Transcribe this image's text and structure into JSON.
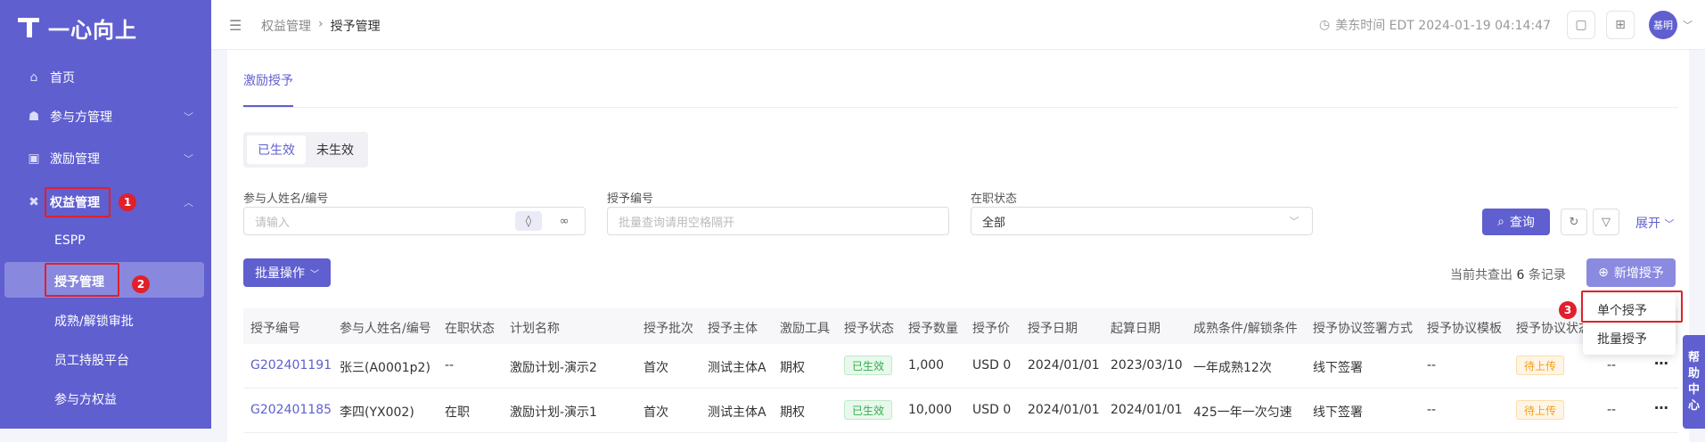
{
  "app": {
    "logo_text": "一心向上"
  },
  "sidebar": {
    "items": [
      {
        "label": "首页",
        "icon": "home-icon"
      },
      {
        "label": "参与方管理",
        "icon": "users-icon"
      },
      {
        "label": "激励管理",
        "icon": "gift-icon"
      },
      {
        "label": "权益管理",
        "icon": "equity-icon"
      }
    ],
    "sub_items": [
      "ESPP",
      "授予管理",
      "成熟/解锁审批",
      "员工持股平台",
      "参与方权益"
    ]
  },
  "annotations": {
    "b1": "1",
    "b2": "2",
    "b3": "3"
  },
  "header": {
    "breadcrumb": [
      "权益管理",
      "授予管理"
    ],
    "time": "美东时间 EDT 2024-01-19 04:14:47",
    "avatar": "基明"
  },
  "page": {
    "tab": "激励授予",
    "segments": [
      "已生效",
      "未生效"
    ],
    "filters": {
      "participant_label": "参与人姓名/编号",
      "participant_placeholder": "请输入",
      "grant_no_label": "授予编号",
      "grant_no_placeholder": "批量查询请用空格隔开",
      "status_label": "在职状态",
      "status_value": "全部"
    },
    "query_btn": "查询",
    "expand": "展开",
    "batch_btn": "批量操作",
    "count_prefix": "当前共查出",
    "count_num": "6",
    "count_suffix": "条记录",
    "add_btn": "新增授予",
    "dropdown": [
      "单个授予",
      "批量授予"
    ]
  },
  "table": {
    "columns": [
      "授予编号",
      "参与人姓名/编号",
      "在职状态",
      "计划名称",
      "授予批次",
      "授予主体",
      "激励工具",
      "授予状态",
      "授予数量",
      "授予价",
      "授予日期",
      "起算日期",
      "成熟条件/解锁条件",
      "授予协议签署方式",
      "授予协议模板",
      "授予协议状态"
    ],
    "rows": [
      [
        "G202401191",
        "张三(A0001p2)",
        "--",
        "激励计划-演示2",
        "首次",
        "测试主体A",
        "期权",
        "已生效",
        "1,000",
        "USD  0",
        "2024/01/01",
        "2023/03/10",
        "一年成熟12次",
        "线下签署",
        "--",
        "待上传",
        "--"
      ],
      [
        "G202401185",
        "李四(YX002)",
        "在职",
        "激励计划-演示1",
        "首次",
        "测试主体A",
        "期权",
        "已生效",
        "10,000",
        "USD  0",
        "2024/01/01",
        "2024/01/01",
        "425一年一次匀速",
        "线下签署",
        "--",
        "待上传",
        "--"
      ]
    ]
  },
  "help": [
    "帮",
    "助",
    "中",
    "心"
  ]
}
